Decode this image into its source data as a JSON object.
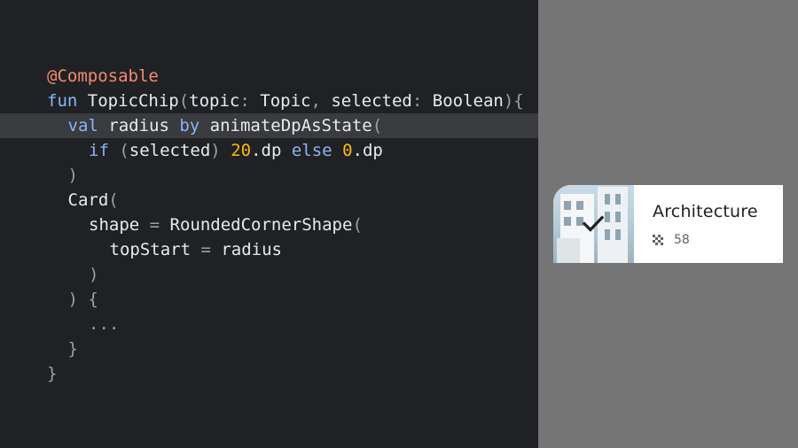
{
  "editor": {
    "lines": [
      {
        "indent": 0,
        "highlight": false,
        "tokens": [
          {
            "t": "@Composable",
            "c": "ann"
          }
        ]
      },
      {
        "indent": 0,
        "highlight": false,
        "tokens": [
          {
            "t": "fun",
            "c": "kw"
          },
          {
            "t": " TopicChip",
            "c": "id"
          },
          {
            "t": "(",
            "c": "punc"
          },
          {
            "t": "topic",
            "c": "id"
          },
          {
            "t": ": ",
            "c": "punc"
          },
          {
            "t": "Topic",
            "c": "id"
          },
          {
            "t": ", ",
            "c": "punc"
          },
          {
            "t": "selected",
            "c": "id"
          },
          {
            "t": ": ",
            "c": "punc"
          },
          {
            "t": "Boolean",
            "c": "id"
          },
          {
            "t": "){",
            "c": "punc"
          }
        ]
      },
      {
        "indent": 1,
        "highlight": true,
        "tokens": [
          {
            "t": "val",
            "c": "kw"
          },
          {
            "t": " radius ",
            "c": "id"
          },
          {
            "t": "by",
            "c": "kw"
          },
          {
            "t": " animateDpAsState",
            "c": "id"
          },
          {
            "t": "(",
            "c": "punc"
          }
        ]
      },
      {
        "indent": 2,
        "highlight": false,
        "tokens": [
          {
            "t": "if",
            "c": "kw"
          },
          {
            "t": " (",
            "c": "punc"
          },
          {
            "t": "selected",
            "c": "id"
          },
          {
            "t": ") ",
            "c": "punc"
          },
          {
            "t": "20",
            "c": "num"
          },
          {
            "t": ".dp ",
            "c": "id"
          },
          {
            "t": "else",
            "c": "kw"
          },
          {
            "t": " ",
            "c": "id"
          },
          {
            "t": "0",
            "c": "num"
          },
          {
            "t": ".dp",
            "c": "id"
          }
        ]
      },
      {
        "indent": 1,
        "highlight": false,
        "tokens": [
          {
            "t": ")",
            "c": "punc"
          }
        ]
      },
      {
        "indent": 1,
        "highlight": false,
        "tokens": [
          {
            "t": "Card",
            "c": "id"
          },
          {
            "t": "(",
            "c": "punc"
          }
        ]
      },
      {
        "indent": 2,
        "highlight": false,
        "tokens": [
          {
            "t": "shape",
            "c": "id"
          },
          {
            "t": " = ",
            "c": "punc"
          },
          {
            "t": "RoundedCornerShape",
            "c": "id"
          },
          {
            "t": "(",
            "c": "punc"
          }
        ]
      },
      {
        "indent": 3,
        "highlight": false,
        "tokens": [
          {
            "t": "topStart",
            "c": "id"
          },
          {
            "t": " = ",
            "c": "punc"
          },
          {
            "t": "radius",
            "c": "id"
          }
        ]
      },
      {
        "indent": 2,
        "highlight": false,
        "tokens": [
          {
            "t": ")",
            "c": "punc"
          }
        ]
      },
      {
        "indent": 1,
        "highlight": false,
        "tokens": [
          {
            "t": ") {",
            "c": "punc"
          }
        ]
      },
      {
        "indent": 2,
        "highlight": false,
        "tokens": [
          {
            "t": "...",
            "c": "punc"
          }
        ]
      },
      {
        "indent": 1,
        "highlight": false,
        "tokens": [
          {
            "t": "}",
            "c": "punc"
          }
        ]
      },
      {
        "indent": 0,
        "highlight": false,
        "tokens": [
          {
            "t": "}",
            "c": "punc"
          }
        ]
      }
    ]
  },
  "preview": {
    "chip": {
      "title": "Architecture",
      "count": "58",
      "selected": true,
      "check_icon": "check-icon",
      "meta_icon": "grid-dots-icon",
      "image": "building-photo"
    }
  },
  "colors": {
    "editor_bg": "#202124",
    "highlight_line": "#3a3b3e",
    "annotation": "#f28b6b",
    "keyword": "#8ab4f8",
    "number": "#fbbc04",
    "preview_bg": "#757575",
    "chip_bg": "#ffffff"
  }
}
